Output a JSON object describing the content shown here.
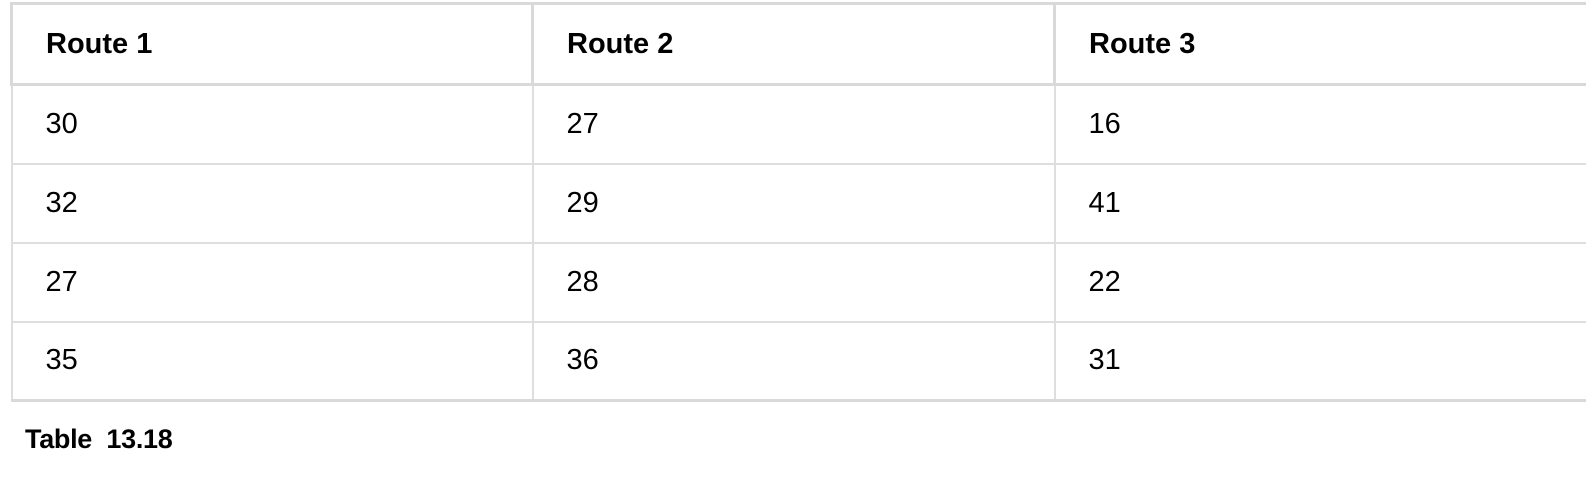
{
  "table": {
    "headers": [
      "Route 1",
      "Route 2",
      "Route 3"
    ],
    "rows": [
      [
        "30",
        "27",
        "16"
      ],
      [
        "32",
        "29",
        "41"
      ],
      [
        "27",
        "28",
        "22"
      ],
      [
        "35",
        "36",
        "31"
      ]
    ]
  },
  "caption": {
    "label": "Table",
    "number": "13.18"
  },
  "colors": {
    "border": "#d9d9d9",
    "text": "#000000",
    "background": "#ffffff"
  }
}
